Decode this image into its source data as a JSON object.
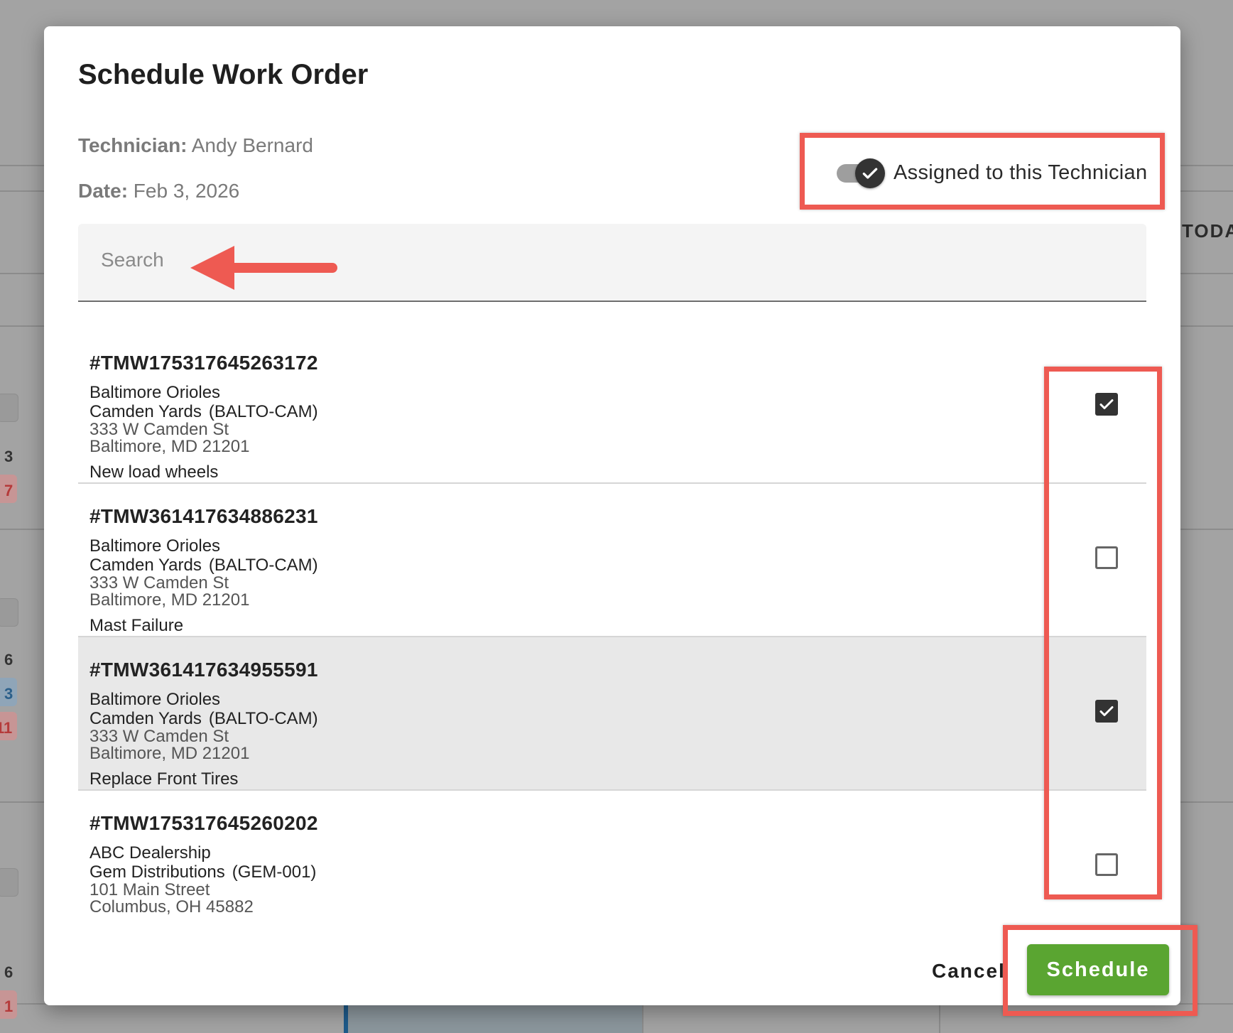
{
  "background": {
    "badges": [
      "3",
      "7",
      "6",
      "3",
      "11",
      "6",
      "1"
    ],
    "today_label": "TODA"
  },
  "dialog": {
    "title": "Schedule Work Order",
    "technician_label": "Technician:",
    "technician_value": "Andy Bernard",
    "date_label": "Date:",
    "date_value": "Feb 3, 2026",
    "toggle": {
      "label": "Assigned to this Technician",
      "checked": true
    },
    "search": {
      "placeholder": "Search",
      "value": ""
    },
    "work_orders": [
      {
        "id": "#TMW175317645263172",
        "customer": "Baltimore Orioles",
        "site": "Camden Yards",
        "site_code": "(BALTO-CAM)",
        "street": "333 W Camden St",
        "city": "Baltimore, MD 21201",
        "description": "New load wheels",
        "checked": true
      },
      {
        "id": "#TMW361417634886231",
        "customer": "Baltimore Orioles",
        "site": "Camden Yards",
        "site_code": "(BALTO-CAM)",
        "street": "333 W Camden St",
        "city": "Baltimore, MD 21201",
        "description": "Mast Failure",
        "checked": false
      },
      {
        "id": "#TMW361417634955591",
        "customer": "Baltimore Orioles",
        "site": "Camden Yards",
        "site_code": "(BALTO-CAM)",
        "street": "333 W Camden St",
        "city": "Baltimore, MD 21201",
        "description": "Replace Front Tires",
        "checked": true
      },
      {
        "id": "#TMW175317645260202",
        "customer": "ABC Dealership",
        "site": "Gem Distributions",
        "site_code": "(GEM-001)",
        "street": "101 Main Street",
        "city": "Columbus, OH 45882",
        "description": "",
        "checked": false
      }
    ],
    "cancel_label": "Cancel",
    "schedule_label": "Schedule"
  },
  "colors": {
    "accent_green": "#5aa531",
    "annotation_red": "#ee5a52",
    "toggle_knob": "#333333",
    "highlight_row": "#e8e8e8"
  }
}
